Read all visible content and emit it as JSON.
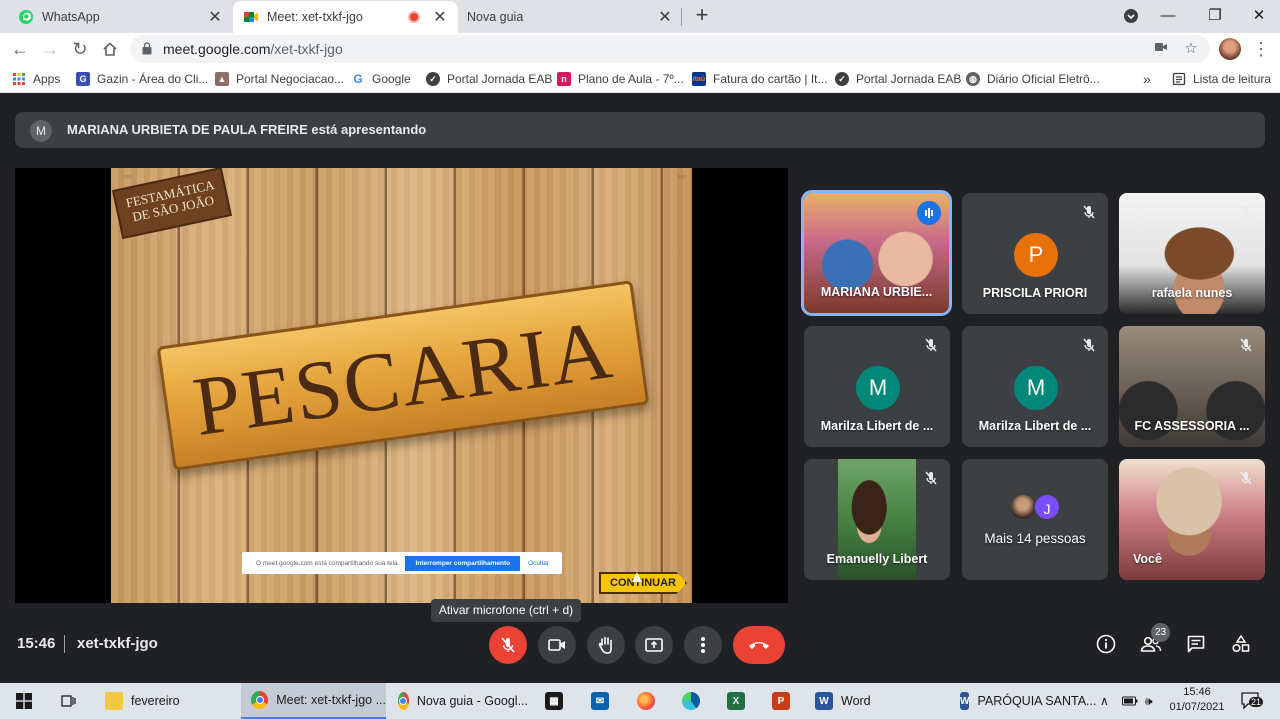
{
  "browser": {
    "tabs": [
      {
        "title": "WhatsApp",
        "active": false
      },
      {
        "title": "Meet: xet-txkf-jgo",
        "active": true
      },
      {
        "title": "Nova guia",
        "active": false
      }
    ],
    "url_host": "meet.google.com",
    "url_path": "/xet-txkf-jgo",
    "bookmarks": [
      {
        "label": "Apps",
        "icon": "apps-grid-icon"
      },
      {
        "label": "Gazin - Área do Cli...",
        "icon": "gazin-icon"
      },
      {
        "label": "Portal Negociacao...",
        "icon": "portal-icon"
      },
      {
        "label": "Google",
        "icon": "google-icon"
      },
      {
        "label": "Portal Jornada EAB",
        "icon": "jornada-icon"
      },
      {
        "label": "Plano de Aula - 7º...",
        "icon": "nova-escola-icon"
      },
      {
        "label": "Fatura do cartão | It...",
        "icon": "itau-icon"
      },
      {
        "label": "Portal Jornada EAB",
        "icon": "jornada-icon"
      },
      {
        "label": "Diário Oficial Eletrô...",
        "icon": "globe-icon"
      }
    ],
    "reading_list": "Lista de leitura"
  },
  "meet": {
    "presenting": {
      "avatar_letter": "M",
      "text": "MARIANA URBIETA DE PAULA FREIRE está apresentando"
    },
    "slide": {
      "badge_line1": "FESTAMÁTICA",
      "badge_line2": "DE SÃO JOÃO",
      "title": "PESCARIA",
      "share_notice": "O meet.google.com está compartilhando sua tela.",
      "stop_sharing": "Interromper compartilhamento",
      "hide": "Ocultar",
      "continue_button": "CONTINUAR"
    },
    "participants": [
      {
        "name": "MARIANA URBIE...",
        "type": "video",
        "speaking": true
      },
      {
        "name": "PRISCILA PRIORI",
        "type": "letter",
        "letter": "P",
        "color": "#e8710a"
      },
      {
        "name": "rafaela nunes",
        "type": "video"
      },
      {
        "name": "Marilza Libert de ...",
        "type": "letter",
        "letter": "M",
        "color": "#00897b"
      },
      {
        "name": "Marilza Libert de ...",
        "type": "letter",
        "letter": "M",
        "color": "#00897b"
      },
      {
        "name": "FC ASSESSORIA ...",
        "type": "video"
      },
      {
        "name": "Emanuelly Libert",
        "type": "video"
      },
      {
        "name": "Mais 14 pessoas",
        "type": "more",
        "letter": "J",
        "color": "#7c4dff"
      },
      {
        "name": "Você",
        "type": "video"
      }
    ],
    "tooltip": "Ativar microfone (ctrl + d)",
    "time": "15:46",
    "meeting_code": "xet-txkf-jgo",
    "people_count": "23",
    "accent_red": "#ea4335"
  },
  "taskbar": {
    "items": [
      {
        "label": "fevereiro",
        "icon": "folder-icon"
      },
      {
        "label": "Meet: xet-txkf-jgo ...",
        "icon": "chrome-icon",
        "active": true
      },
      {
        "label": "Nova guia - Googl...",
        "icon": "chrome-icon"
      },
      {
        "label": "Word",
        "icon": "word-icon"
      },
      {
        "label": "PARÓQUIA SANTA...",
        "icon": "word-icon"
      }
    ],
    "clock_time": "15:46",
    "clock_date": "01/07/2021",
    "notifications_count": "21"
  }
}
